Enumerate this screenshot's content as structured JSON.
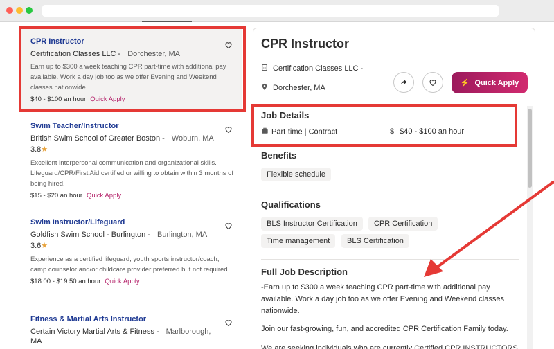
{
  "colors": {
    "accent": "#b5246b",
    "title_blue": "#1f3a93",
    "annotation_red": "#e53935"
  },
  "job_list": [
    {
      "title": "CPR Instructor",
      "company": "Certification Classes LLC -",
      "location": "Dorchester, MA",
      "rating": "",
      "snippet": "Earn up to $300 a week teaching CPR part-time with additional pay available. Work a day job too as we offer Evening and Weekend classes nationwide.",
      "pay": "$40 - $100 an hour",
      "quick_apply": "Quick Apply"
    },
    {
      "title": "Swim Teacher/Instructor",
      "company": "British Swim School of Greater Boston -",
      "location": "Woburn, MA",
      "rating": "3.8",
      "snippet": "Excellent interpersonal communication and organizational skills. Lifeguard/CPR/First Aid certified or willing to obtain within 3 months of being hired.",
      "pay": "$15 - $20 an hour",
      "quick_apply": "Quick Apply"
    },
    {
      "title": "Swim Instructor/Lifeguard",
      "company": "Goldfish Swim School - Burlington -",
      "location": "Burlington, MA",
      "rating": "3.6",
      "snippet": "Experience as a certified lifeguard, youth sports instructor/coach, camp counselor and/or childcare provider preferred but not required.",
      "pay": "$18.00 - $19.50 an hour",
      "quick_apply": "Quick Apply"
    },
    {
      "title": "Fitness & Martial Arts Instructor",
      "company": "Certain Victory Martial Arts & Fitness -",
      "location": "Marlborough,",
      "location_cont": "MA"
    }
  ],
  "details": {
    "title": "CPR Instructor",
    "company": "Certification Classes LLC -",
    "location": "Dorchester, MA",
    "quick_apply_label": "Quick Apply",
    "job_details_heading": "Job Details",
    "job_type": "Part-time | Contract",
    "pay": "$40 - $100 an hour",
    "benefits_heading": "Benefits",
    "benefits": [
      "Flexible schedule"
    ],
    "qualifications_heading": "Qualifications",
    "qualifications": [
      "BLS Instructor Certification",
      "CPR Certification",
      "Time management",
      "BLS Certification"
    ],
    "full_desc_heading": "Full Job Description",
    "desc_p1": "-Earn up to $300 a week teaching CPR part-time with additional pay available. Work a day job too as we offer Evening and Weekend classes nationwide.",
    "desc_p2": "Join our fast-growing, fun, and accredited CPR Certification Family today.",
    "desc_p3": "We are seeking individuals who are currently Certified CPR INSTRUCTORS"
  }
}
